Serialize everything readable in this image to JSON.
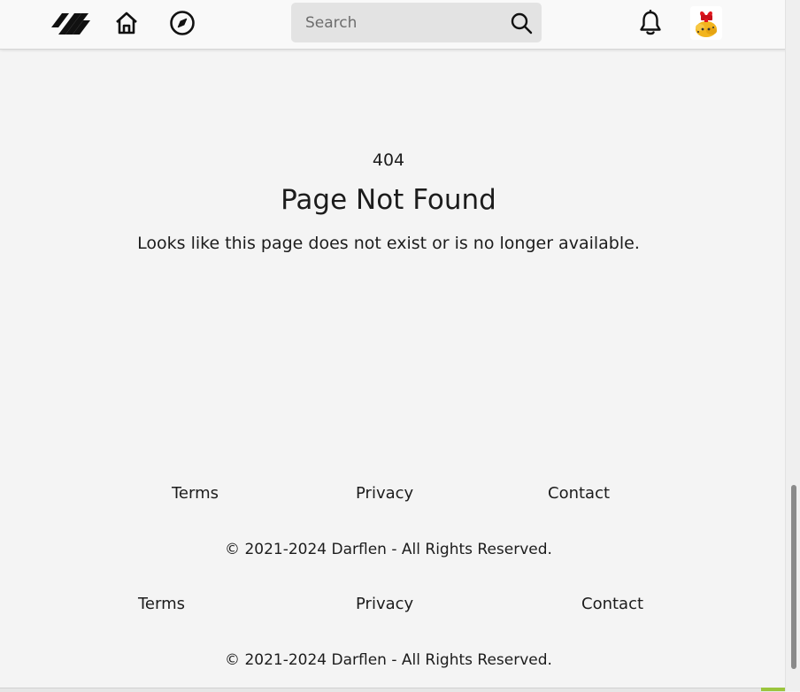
{
  "header": {
    "search": {
      "placeholder": "Search"
    },
    "icons": {
      "logo": "brand-stripes-logo",
      "home": "home-icon",
      "explore": "compass-icon",
      "search": "magnifier-icon",
      "notifications": "bell-icon",
      "avatar": "christmas-gift-avatar"
    }
  },
  "error": {
    "code": "404",
    "title": "Page Not Found",
    "message": "Looks like this page does not exist or is no longer available."
  },
  "footers": [
    {
      "links": [
        "Terms",
        "Privacy",
        "Contact"
      ],
      "copyright": "© 2021-2024 Darflen - All Rights Reserved."
    },
    {
      "links": [
        "Terms",
        "Privacy",
        "Contact"
      ],
      "copyright": "© 2021-2024 Darflen - All Rights Reserved."
    }
  ],
  "colors": {
    "background": "#f4f4f4",
    "header_bg": "#f9f9f9",
    "search_bg": "#e3e3e3",
    "text": "#1c1c1c"
  }
}
